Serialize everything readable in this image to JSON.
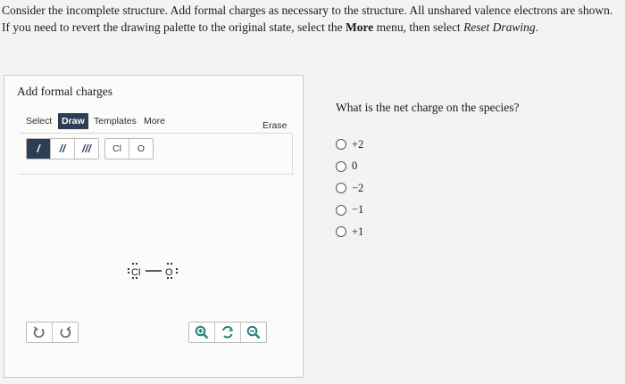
{
  "instructions": {
    "line1": "Consider the incomplete structure. Add formal charges as necessary to the structure. All unshared valence electrons are shown.",
    "line2_a": "If you need to revert the drawing palette to the original state, select the ",
    "line2_more": "More",
    "line2_b": " menu, then select ",
    "line2_reset": "Reset Drawing",
    "line2_end": "."
  },
  "panel": {
    "title": "Add formal charges",
    "tabs": {
      "select": "Select",
      "draw": "Draw",
      "templates": "Templates",
      "more": "More"
    },
    "erase": "Erase",
    "bonds": {
      "single": "/",
      "double": "//",
      "triple": "///"
    },
    "atoms": {
      "cl": "Cl",
      "o": "O"
    },
    "molecule": {
      "atom1": "Cl",
      "atom2": "O"
    }
  },
  "question": {
    "prompt": "What is the net charge on the species?",
    "options": [
      "+2",
      "0",
      "−2",
      "−1",
      "+1"
    ]
  },
  "colors": {
    "accent": "#2c3d55",
    "button_green": "#2e7d7a"
  }
}
